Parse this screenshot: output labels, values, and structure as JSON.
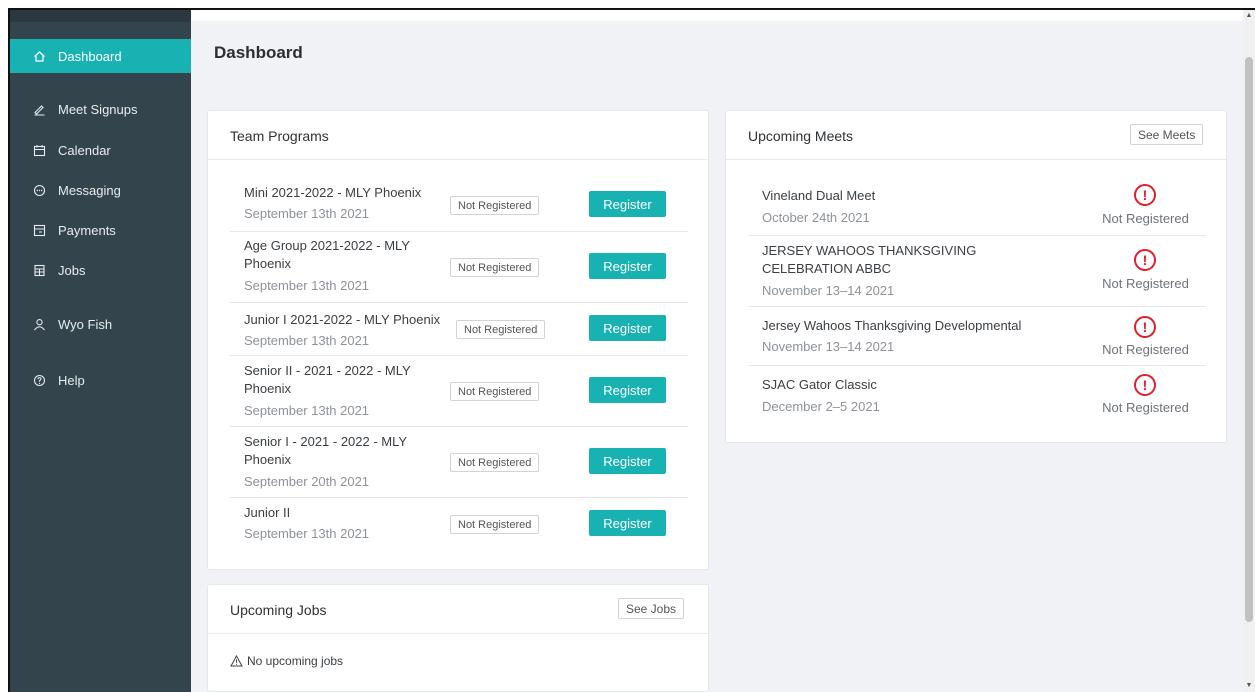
{
  "sidebar": {
    "items": [
      {
        "label": "Dashboard",
        "icon": "home-icon",
        "active": true
      },
      {
        "label": "Meet Signups",
        "icon": "pencil-icon"
      },
      {
        "label": "Calendar",
        "icon": "calendar-icon"
      },
      {
        "label": "Messaging",
        "icon": "chat-icon"
      },
      {
        "label": "Payments",
        "icon": "payment-icon"
      },
      {
        "label": "Jobs",
        "icon": "jobs-icon"
      },
      {
        "label": "Wyo Fish",
        "icon": "user-icon"
      },
      {
        "label": "Help",
        "icon": "help-icon"
      }
    ]
  },
  "page": {
    "title": "Dashboard"
  },
  "team_programs": {
    "title": "Team Programs",
    "status_label": "Not Registered",
    "register_label": "Register",
    "programs": [
      {
        "name": "Mini 2021-2022 - MLY Phoenix",
        "date": "September 13th 2021"
      },
      {
        "name": "Age Group 2021-2022 - MLY Phoenix",
        "date": "September 13th 2021"
      },
      {
        "name": "Junior I 2021-2022 - MLY Phoenix",
        "date": "September 13th 2021"
      },
      {
        "name": "Senior II - 2021 - 2022 - MLY Phoenix",
        "date": "September 13th 2021"
      },
      {
        "name": "Senior I - 2021 - 2022 - MLY Phoenix",
        "date": "September 20th 2021"
      },
      {
        "name": "Junior II",
        "date": "September 13th 2021"
      }
    ]
  },
  "upcoming_jobs": {
    "title": "Upcoming Jobs",
    "see_button": "See Jobs",
    "empty_text": "No upcoming jobs"
  },
  "upcoming_meets": {
    "title": "Upcoming Meets",
    "see_button": "See Meets",
    "status_label": "Not Registered",
    "meets": [
      {
        "name": "Vineland Dual Meet",
        "date": "October 24th 2021"
      },
      {
        "name": "JERSEY WAHOOS THANKSGIVING CELEBRATION ABBC",
        "date": "November 13–14 2021"
      },
      {
        "name": "Jersey Wahoos Thanksgiving Developmental",
        "date": "November 13–14 2021"
      },
      {
        "name": "SJAC Gator Classic",
        "date": "December 2–5 2021"
      }
    ]
  },
  "colors": {
    "accent": "#19b2b2",
    "sidebar": "#34444c",
    "alert": "#e0202a"
  }
}
